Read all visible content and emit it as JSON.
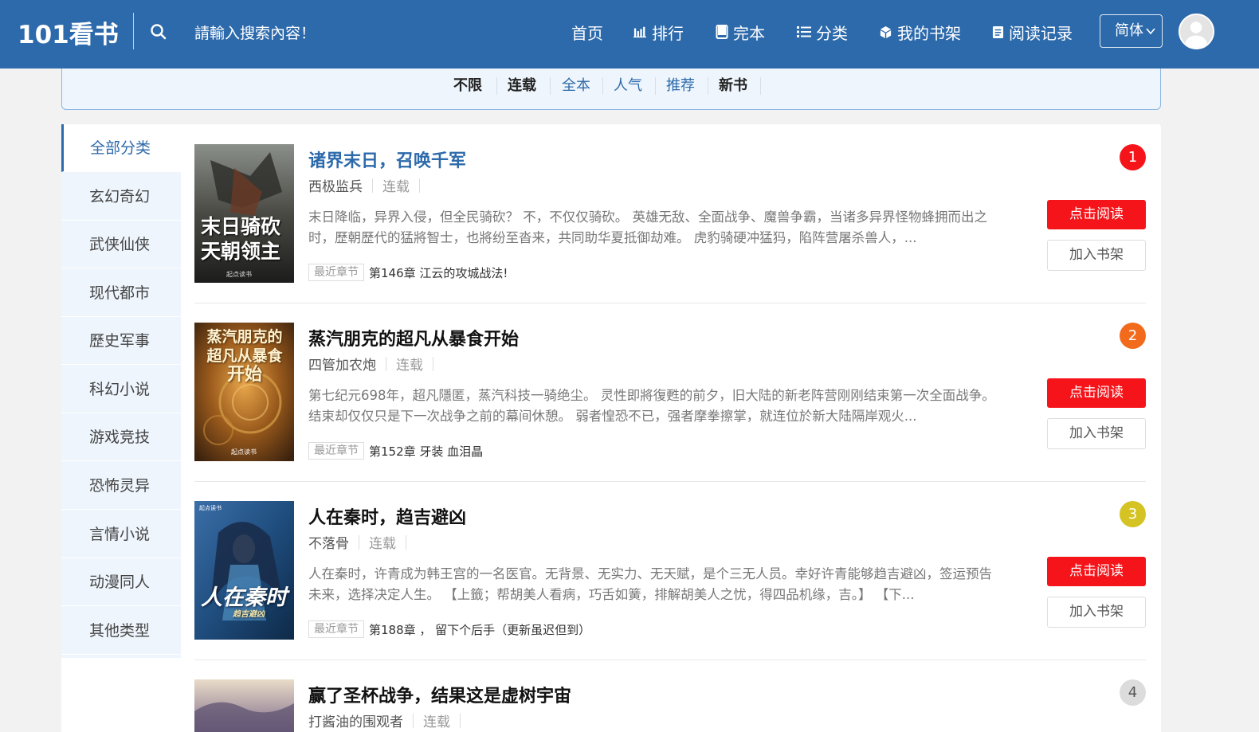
{
  "header": {
    "logo": "101看书",
    "search_placeholder": "請輸入搜索內容！",
    "nav": [
      {
        "label": "首页",
        "icon": ""
      },
      {
        "label": "排行",
        "icon": "bar-chart-icon"
      },
      {
        "label": "完本",
        "icon": "book-icon"
      },
      {
        "label": "分类",
        "icon": "list-icon"
      },
      {
        "label": "我的书架",
        "icon": "cube-icon"
      },
      {
        "label": "阅读记录",
        "icon": "document-icon"
      }
    ],
    "lang": "简体",
    "accent": "#2d6aab"
  },
  "filters": [
    {
      "label": "不限",
      "style": "bold"
    },
    {
      "label": "连载",
      "style": "bold"
    },
    {
      "label": "全本",
      "style": "link"
    },
    {
      "label": "人气",
      "style": "link"
    },
    {
      "label": "推荐",
      "style": "link"
    },
    {
      "label": "新书",
      "style": "bold"
    }
  ],
  "sidebar": {
    "items": [
      "全部分类",
      "玄幻奇幻",
      "武侠仙侠",
      "现代都市",
      "歷史军事",
      "科幻小说",
      "游戏竞技",
      "恐怖灵异",
      "言情小说",
      "动漫同人",
      "其他类型"
    ]
  },
  "books": [
    {
      "rank": "1",
      "rank_color": "#f5141a",
      "title": "诸界末日，召唤千军",
      "author": "西极监兵",
      "status": "连载",
      "desc": "末日降临，异界入侵，但全民骑砍？ 不，不仅仅骑砍。 英雄无敌、全面战争、魔兽争霸，当诸多异界怪物蜂拥而出之时，歷朝歷代的猛將智士，也將纷至沓来，共同助华夏抵御劫难。 虎豹骑硬冲猛犸，陷阵营屠杀兽人，...",
      "latest_tag": "最近章节",
      "latest": "第146章 江云的攻城战法!",
      "read_label": "点击阅读",
      "shelf_label": "加入书架",
      "cover_text": [
        "末日骑砍",
        "天朝领主"
      ],
      "cover_publisher": "起点读书"
    },
    {
      "rank": "2",
      "rank_color": "#f26b1d",
      "title": "蒸汽朋克的超凡从暴食开始",
      "author": "四管加农炮",
      "status": "连载",
      "desc": "第七纪元698年，超凡隱匿，蒸汽科技一骑绝尘。 灵性即將復甦的前夕，旧大陆的新老阵营刚刚结束第一次全面战争。 结束却仅仅只是下一次战争之前的幕间休憩。 弱者惶恐不已，强者摩拳擦掌，就连位於新大陆隔岸观火...",
      "latest_tag": "最近章节",
      "latest": "第152章 牙装 血泪晶",
      "read_label": "点击阅读",
      "shelf_label": "加入书架",
      "cover_text": [
        "蒸汽朋克的",
        "超凡从暴食",
        "开始"
      ],
      "cover_publisher": "起点读书"
    },
    {
      "rank": "3",
      "rank_color": "#d4c322",
      "title": "人在秦时，趋吉避凶",
      "author": "不落骨",
      "status": "连载",
      "desc": "人在秦时，许青成为韩王宫的一名医官。无背景、无实力、无天赋，是个三无人员。幸好许青能够趋吉避凶，签运预告未来，选择决定人生。 【上籤；帮胡美人看病，巧舌如簧，排解胡美人之忧，得四品机缘，吉。】 【下...",
      "latest_tag": "最近章节",
      "latest": "第188章 ， 留下个后手（更新虽迟但到）",
      "read_label": "点击阅读",
      "shelf_label": "加入书架",
      "cover_text": [
        "人在秦时",
        "趋吉避凶"
      ],
      "cover_publisher": "起点读书"
    },
    {
      "rank": "4",
      "rank_color": "#dcdcdc",
      "title": "赢了圣杯战争，结果这是虚树宇宙",
      "author": "打酱油的围观者",
      "status": "连载"
    }
  ]
}
